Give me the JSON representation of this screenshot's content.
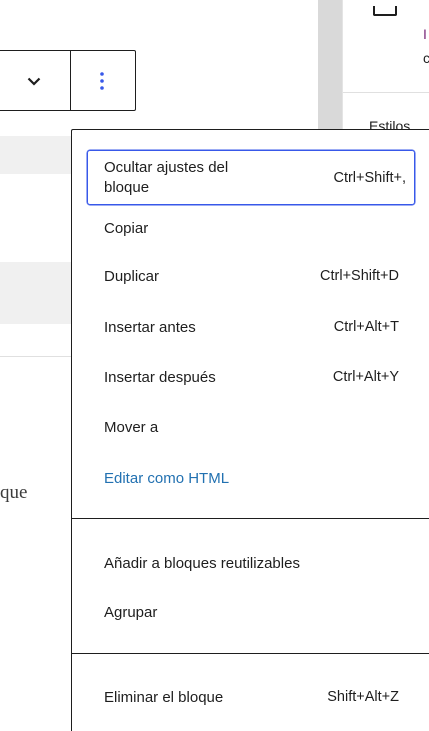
{
  "sidebar": {
    "text_top_1": "I",
    "text_top_2": "c",
    "styles_tab": "Estilos"
  },
  "editor": {
    "partial_text": "que"
  },
  "block_menu": {
    "items": [
      {
        "label": "Ocultar ajustes del bloque",
        "shortcut": "Ctrl+Shift+,"
      },
      {
        "label": "Copiar",
        "shortcut": ""
      },
      {
        "label": "Duplicar",
        "shortcut": "Ctrl+Shift+D"
      },
      {
        "label": "Insertar antes",
        "shortcut": "Ctrl+Alt+T"
      },
      {
        "label": "Insertar después",
        "shortcut": "Ctrl+Alt+Y"
      },
      {
        "label": "Mover a",
        "shortcut": ""
      },
      {
        "label": "Editar como HTML",
        "shortcut": ""
      },
      {
        "label": "Añadir a bloques reutilizables",
        "shortcut": ""
      },
      {
        "label": "Agrupar",
        "shortcut": ""
      },
      {
        "label": "Eliminar el bloque",
        "shortcut": "Shift+Alt+Z"
      }
    ]
  },
  "colors": {
    "accent": "#3858e9",
    "link": "#2271b1",
    "sidebar_text_accent": "#7a2a7a"
  },
  "icons": {
    "toolbar_chevron": "chevron-down-icon",
    "toolbar_options": "more-vertical-icon"
  }
}
